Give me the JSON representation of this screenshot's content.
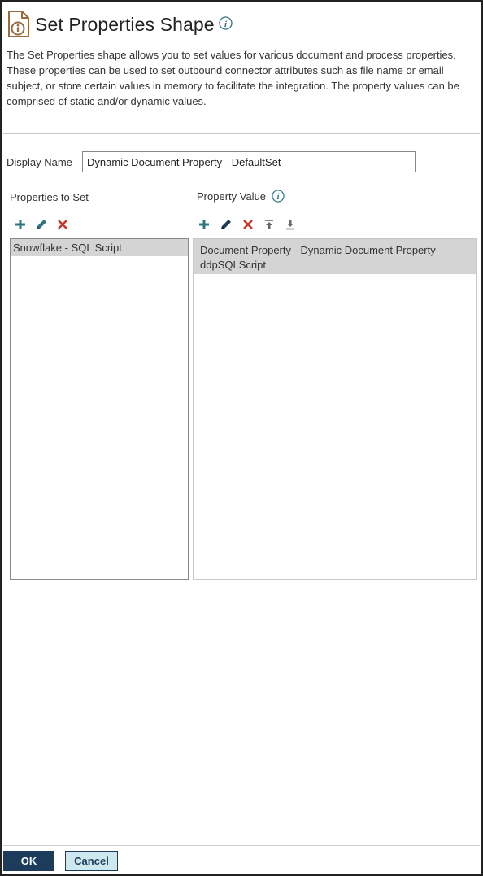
{
  "header": {
    "title": "Set Properties Shape",
    "icon": "document-info-icon",
    "help_icon": "info-icon"
  },
  "description": "The Set Properties shape allows you to set values for various document and process properties. These properties can be used to set outbound connector attributes such as file name or email subject, or store certain values in memory to facilitate the integration. The property values can be comprised of static and/or dynamic values.",
  "display_name": {
    "label": "Display Name",
    "value": "Dynamic Document Property - DefaultSet"
  },
  "properties_to_set": {
    "label": "Properties to Set",
    "toolbar": [
      "add-icon",
      "edit-icon",
      "delete-icon"
    ],
    "items": [
      "Snowflake - SQL Script"
    ]
  },
  "property_value": {
    "label": "Property Value",
    "toolbar": [
      "add-icon",
      "edit-icon",
      "delete-icon",
      "move-top-icon",
      "move-bottom-icon"
    ],
    "items": [
      "Document Property - Dynamic Document Property - ddpSQLScript"
    ]
  },
  "footer": {
    "ok_label": "OK",
    "cancel_label": "Cancel"
  },
  "colors": {
    "accent_brown": "#9a6a3c",
    "toolbar_teal": "#2d7583",
    "delete_red": "#c0392b",
    "ok_bg": "#1d3c5c",
    "cancel_bg": "#cde8ee",
    "selected_row": "#d4d4d4"
  }
}
